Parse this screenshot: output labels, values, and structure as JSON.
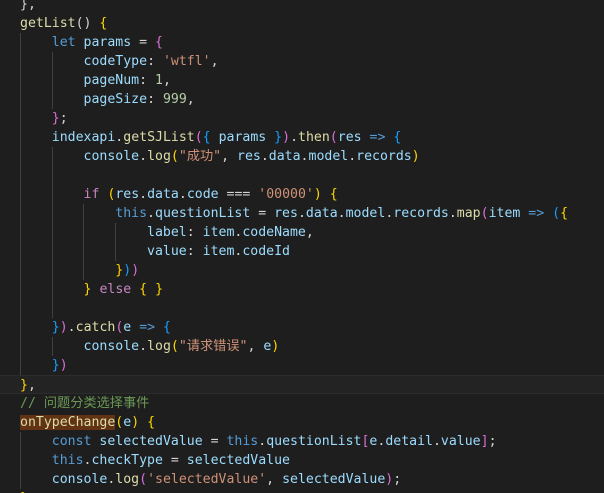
{
  "editor": {
    "theme": {
      "background": "#1e1e1e",
      "keyword": "#569cd6",
      "control": "#c586c0",
      "function": "#dcdcaa",
      "variable": "#9cdcfe",
      "string": "#ce9178",
      "number": "#b5cea8",
      "comment": "#6a9955"
    },
    "lines": [
      {
        "tokens": [
          {
            "t": "},",
            "c": "pl"
          }
        ]
      },
      {
        "tokens": [
          {
            "t": "getList",
            "c": "fn"
          },
          {
            "t": "() ",
            "c": "pl"
          },
          {
            "t": "{",
            "c": "b1"
          }
        ]
      },
      {
        "tokens": [
          {
            "t": "    ",
            "c": "pl"
          },
          {
            "t": "let",
            "c": "kw"
          },
          {
            "t": " ",
            "c": "pl"
          },
          {
            "t": "params",
            "c": "var"
          },
          {
            "t": " = ",
            "c": "pl"
          },
          {
            "t": "{",
            "c": "b2"
          }
        ]
      },
      {
        "tokens": [
          {
            "t": "        ",
            "c": "pl"
          },
          {
            "t": "codeType",
            "c": "var"
          },
          {
            "t": ": ",
            "c": "pl"
          },
          {
            "t": "'wtfl'",
            "c": "str"
          },
          {
            "t": ",",
            "c": "pl"
          }
        ]
      },
      {
        "tokens": [
          {
            "t": "        ",
            "c": "pl"
          },
          {
            "t": "pageNum",
            "c": "var"
          },
          {
            "t": ": ",
            "c": "pl"
          },
          {
            "t": "1",
            "c": "num"
          },
          {
            "t": ",",
            "c": "pl"
          }
        ]
      },
      {
        "tokens": [
          {
            "t": "        ",
            "c": "pl"
          },
          {
            "t": "pageSize",
            "c": "var"
          },
          {
            "t": ": ",
            "c": "pl"
          },
          {
            "t": "999",
            "c": "num"
          },
          {
            "t": ",",
            "c": "pl"
          }
        ]
      },
      {
        "tokens": [
          {
            "t": "    ",
            "c": "pl"
          },
          {
            "t": "}",
            "c": "b2"
          },
          {
            "t": ";",
            "c": "pl"
          }
        ]
      },
      {
        "tokens": [
          {
            "t": "    ",
            "c": "pl"
          },
          {
            "t": "indexapi",
            "c": "var"
          },
          {
            "t": ".",
            "c": "pl"
          },
          {
            "t": "getSJList",
            "c": "fn"
          },
          {
            "t": "(",
            "c": "b2"
          },
          {
            "t": "{",
            "c": "b3"
          },
          {
            "t": " ",
            "c": "pl"
          },
          {
            "t": "params",
            "c": "var"
          },
          {
            "t": " ",
            "c": "pl"
          },
          {
            "t": "}",
            "c": "b3"
          },
          {
            "t": ")",
            "c": "b2"
          },
          {
            "t": ".",
            "c": "pl"
          },
          {
            "t": "then",
            "c": "fn"
          },
          {
            "t": "(",
            "c": "b2"
          },
          {
            "t": "res",
            "c": "var"
          },
          {
            "t": " ",
            "c": "pl"
          },
          {
            "t": "=>",
            "c": "kw"
          },
          {
            "t": " ",
            "c": "pl"
          },
          {
            "t": "{",
            "c": "b3"
          }
        ]
      },
      {
        "tokens": [
          {
            "t": "        ",
            "c": "pl"
          },
          {
            "t": "console",
            "c": "var"
          },
          {
            "t": ".",
            "c": "pl"
          },
          {
            "t": "log",
            "c": "fn"
          },
          {
            "t": "(",
            "c": "b1"
          },
          {
            "t": "\"成功\"",
            "c": "str"
          },
          {
            "t": ", ",
            "c": "pl"
          },
          {
            "t": "res",
            "c": "var"
          },
          {
            "t": ".",
            "c": "pl"
          },
          {
            "t": "data",
            "c": "var"
          },
          {
            "t": ".",
            "c": "pl"
          },
          {
            "t": "model",
            "c": "var"
          },
          {
            "t": ".",
            "c": "pl"
          },
          {
            "t": "records",
            "c": "var"
          },
          {
            "t": ")",
            "c": "b1"
          }
        ]
      },
      {
        "tokens": [
          {
            "t": "",
            "c": "pl"
          }
        ]
      },
      {
        "tokens": [
          {
            "t": "        ",
            "c": "pl"
          },
          {
            "t": "if",
            "c": "ctl"
          },
          {
            "t": " ",
            "c": "pl"
          },
          {
            "t": "(",
            "c": "b1"
          },
          {
            "t": "res",
            "c": "var"
          },
          {
            "t": ".",
            "c": "pl"
          },
          {
            "t": "data",
            "c": "var"
          },
          {
            "t": ".",
            "c": "pl"
          },
          {
            "t": "code",
            "c": "var"
          },
          {
            "t": " === ",
            "c": "pl"
          },
          {
            "t": "'00000'",
            "c": "str"
          },
          {
            "t": ")",
            "c": "b1"
          },
          {
            "t": " ",
            "c": "pl"
          },
          {
            "t": "{",
            "c": "b1"
          }
        ]
      },
      {
        "tokens": [
          {
            "t": "            ",
            "c": "pl"
          },
          {
            "t": "this",
            "c": "kw"
          },
          {
            "t": ".",
            "c": "pl"
          },
          {
            "t": "questionList",
            "c": "var"
          },
          {
            "t": " = ",
            "c": "pl"
          },
          {
            "t": "res",
            "c": "var"
          },
          {
            "t": ".",
            "c": "pl"
          },
          {
            "t": "data",
            "c": "var"
          },
          {
            "t": ".",
            "c": "pl"
          },
          {
            "t": "model",
            "c": "var"
          },
          {
            "t": ".",
            "c": "pl"
          },
          {
            "t": "records",
            "c": "var"
          },
          {
            "t": ".",
            "c": "pl"
          },
          {
            "t": "map",
            "c": "fn"
          },
          {
            "t": "(",
            "c": "b2"
          },
          {
            "t": "item",
            "c": "var"
          },
          {
            "t": " ",
            "c": "pl"
          },
          {
            "t": "=>",
            "c": "kw"
          },
          {
            "t": " ",
            "c": "pl"
          },
          {
            "t": "(",
            "c": "b3"
          },
          {
            "t": "{",
            "c": "b1"
          }
        ]
      },
      {
        "tokens": [
          {
            "t": "                ",
            "c": "pl"
          },
          {
            "t": "label",
            "c": "var"
          },
          {
            "t": ": ",
            "c": "pl"
          },
          {
            "t": "item",
            "c": "var"
          },
          {
            "t": ".",
            "c": "pl"
          },
          {
            "t": "codeName",
            "c": "var"
          },
          {
            "t": ",",
            "c": "pl"
          }
        ]
      },
      {
        "tokens": [
          {
            "t": "                ",
            "c": "pl"
          },
          {
            "t": "value",
            "c": "var"
          },
          {
            "t": ": ",
            "c": "pl"
          },
          {
            "t": "item",
            "c": "var"
          },
          {
            "t": ".",
            "c": "pl"
          },
          {
            "t": "codeId",
            "c": "var"
          }
        ]
      },
      {
        "tokens": [
          {
            "t": "            ",
            "c": "pl"
          },
          {
            "t": "}",
            "c": "b1"
          },
          {
            "t": ")",
            "c": "b3"
          },
          {
            "t": ")",
            "c": "b2"
          }
        ]
      },
      {
        "tokens": [
          {
            "t": "        ",
            "c": "pl"
          },
          {
            "t": "}",
            "c": "b1"
          },
          {
            "t": " ",
            "c": "pl"
          },
          {
            "t": "else",
            "c": "ctl"
          },
          {
            "t": " ",
            "c": "pl"
          },
          {
            "t": "{",
            "c": "b1"
          },
          {
            "t": " ",
            "c": "pl"
          },
          {
            "t": "}",
            "c": "b1"
          }
        ]
      },
      {
        "tokens": [
          {
            "t": "",
            "c": "pl"
          }
        ]
      },
      {
        "tokens": [
          {
            "t": "    ",
            "c": "pl"
          },
          {
            "t": "}",
            "c": "b3"
          },
          {
            "t": ")",
            "c": "b2"
          },
          {
            "t": ".",
            "c": "pl"
          },
          {
            "t": "catch",
            "c": "fn"
          },
          {
            "t": "(",
            "c": "b2"
          },
          {
            "t": "e",
            "c": "var"
          },
          {
            "t": " ",
            "c": "pl"
          },
          {
            "t": "=>",
            "c": "kw"
          },
          {
            "t": " ",
            "c": "pl"
          },
          {
            "t": "{",
            "c": "b3"
          }
        ]
      },
      {
        "tokens": [
          {
            "t": "        ",
            "c": "pl"
          },
          {
            "t": "console",
            "c": "var"
          },
          {
            "t": ".",
            "c": "pl"
          },
          {
            "t": "log",
            "c": "fn"
          },
          {
            "t": "(",
            "c": "b1"
          },
          {
            "t": "\"请求错误\"",
            "c": "str"
          },
          {
            "t": ", ",
            "c": "pl"
          },
          {
            "t": "e",
            "c": "var"
          },
          {
            "t": ")",
            "c": "b1"
          }
        ]
      },
      {
        "tokens": [
          {
            "t": "    ",
            "c": "pl"
          },
          {
            "t": "}",
            "c": "b3"
          },
          {
            "t": ")",
            "c": "b2"
          }
        ]
      },
      {
        "tokens": [
          {
            "t": "}",
            "c": "b1"
          },
          {
            "t": ",",
            "c": "pl"
          }
        ],
        "current": true
      },
      {
        "tokens": [
          {
            "t": "// 问题分类选择事件",
            "c": "com"
          }
        ]
      },
      {
        "tokens": [
          {
            "t": "onTypeChange",
            "c": "hl"
          },
          {
            "t": "(",
            "c": "b1"
          },
          {
            "t": "e",
            "c": "var"
          },
          {
            "t": ")",
            "c": "b1"
          },
          {
            "t": " ",
            "c": "pl"
          },
          {
            "t": "{",
            "c": "b1"
          }
        ]
      },
      {
        "tokens": [
          {
            "t": "    ",
            "c": "pl"
          },
          {
            "t": "const",
            "c": "kw"
          },
          {
            "t": " ",
            "c": "pl"
          },
          {
            "t": "selectedValue",
            "c": "var"
          },
          {
            "t": " = ",
            "c": "pl"
          },
          {
            "t": "this",
            "c": "kw"
          },
          {
            "t": ".",
            "c": "pl"
          },
          {
            "t": "questionList",
            "c": "var"
          },
          {
            "t": "[",
            "c": "b2"
          },
          {
            "t": "e",
            "c": "var"
          },
          {
            "t": ".",
            "c": "pl"
          },
          {
            "t": "detail",
            "c": "var"
          },
          {
            "t": ".",
            "c": "pl"
          },
          {
            "t": "value",
            "c": "var"
          },
          {
            "t": "]",
            "c": "b2"
          },
          {
            "t": ";",
            "c": "pl"
          }
        ]
      },
      {
        "tokens": [
          {
            "t": "    ",
            "c": "pl"
          },
          {
            "t": "this",
            "c": "kw"
          },
          {
            "t": ".",
            "c": "pl"
          },
          {
            "t": "checkType",
            "c": "var"
          },
          {
            "t": " = ",
            "c": "pl"
          },
          {
            "t": "selectedValue",
            "c": "var"
          }
        ]
      },
      {
        "tokens": [
          {
            "t": "    ",
            "c": "pl"
          },
          {
            "t": "console",
            "c": "var"
          },
          {
            "t": ".",
            "c": "pl"
          },
          {
            "t": "log",
            "c": "fn"
          },
          {
            "t": "(",
            "c": "b2"
          },
          {
            "t": "'selectedValue'",
            "c": "str"
          },
          {
            "t": ", ",
            "c": "pl"
          },
          {
            "t": "selectedValue",
            "c": "var"
          },
          {
            "t": ")",
            "c": "b2"
          },
          {
            "t": ";",
            "c": "pl"
          }
        ]
      },
      {
        "tokens": [
          {
            "t": "}",
            "c": "b1"
          }
        ]
      }
    ]
  }
}
